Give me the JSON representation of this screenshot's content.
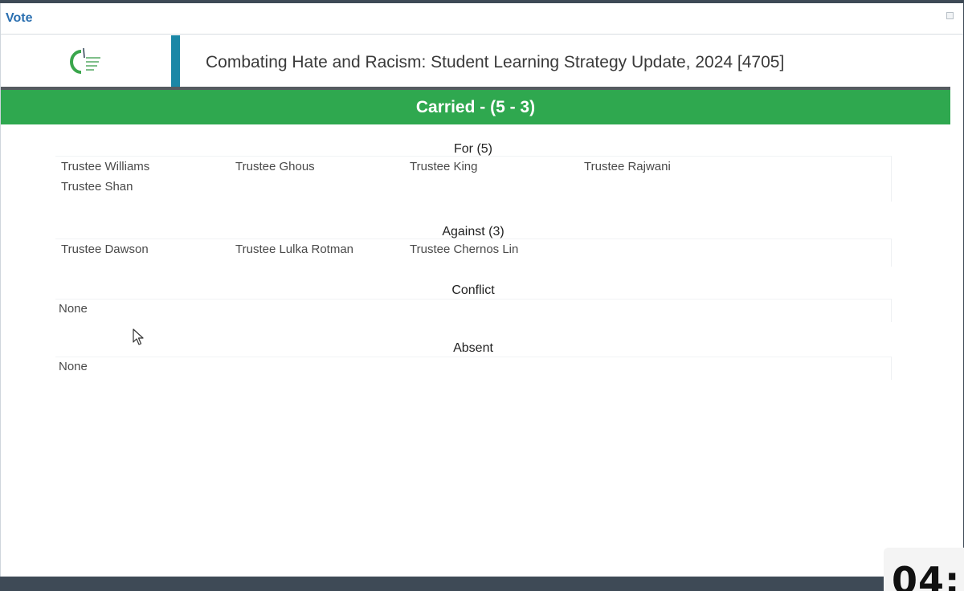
{
  "window": {
    "title": "Vote"
  },
  "header": {
    "logo": "school-board-logo",
    "meeting_title": "Combating Hate and Racism: Student Learning Strategy Update, 2024 [4705]"
  },
  "result": {
    "label": "Carried - (5 - 3)"
  },
  "sections": {
    "for": {
      "heading": "For (5)",
      "names": [
        "Trustee Williams",
        "Trustee Ghous",
        "Trustee King",
        "Trustee Rajwani",
        "Trustee Shan"
      ]
    },
    "against": {
      "heading": "Against (3)",
      "names": [
        "Trustee Dawson",
        "Trustee Lulka Rotman",
        "Trustee Chernos Lin"
      ]
    },
    "conflict": {
      "heading": "Conflict",
      "none_label": "None"
    },
    "absent": {
      "heading": "Absent",
      "none_label": "None"
    }
  },
  "overlay": {
    "clock_text": "04:"
  },
  "colors": {
    "result_green": "#2fa84f",
    "accent_teal": "#1b87a6",
    "title_blue": "#2a6fb0"
  }
}
